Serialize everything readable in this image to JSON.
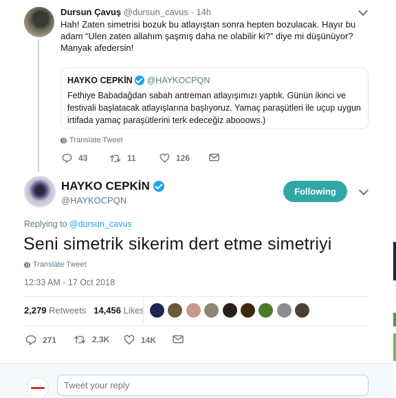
{
  "parent_tweet": {
    "display_name": "Dursun Çavuş",
    "handle": "@dursun_cavus",
    "time": "· 14h",
    "text": "Hah! Zaten simetrisi bozuk bu atlayıştan sonra hepten bozulacak. Hayır bu adam “Ulen zaten allahım şaşmış daha ne olabilir ki?” diye mi düşünüyor? Manyak afedersin!",
    "quoted_tweet": {
      "display_name": "HAYKO CEPKİN",
      "handle": "@HAYKOCPQN",
      "text": "Fethiye Babadağdan sabah antreman atlayışımızı yaptık. Günün ikinci ve festivali başlatacak atlayışlarına başlıyoruz. Yamaç paraşütleri ile uçup uygun irtifada yamaç paraşütlerini terk edeceğiz abooows.)"
    },
    "translate_label": "Translate Tweet",
    "actions": {
      "replies": "43",
      "retweets": "11",
      "likes": "126"
    }
  },
  "main_tweet": {
    "display_name": "HAYKO CEPKİN",
    "handle": "@HAYKOCPQN",
    "follow_label": "Following",
    "replying_prefix": "Replying to",
    "replying_to": "@dursun_cavus",
    "text": "Seni simetrik sikerim dert etme simetriyi",
    "translate_label": "Translate Tweet",
    "timestamp": "12:33 AM - 17 Oct 2018",
    "stats": {
      "retweets_count": "2,279",
      "retweets_label": "Retweets",
      "likes_count": "14,456",
      "likes_label": "Likes"
    },
    "actions": {
      "replies": "271",
      "retweets": "2.3K",
      "likes": "14K"
    }
  },
  "reply_box": {
    "placeholder": "Tweet your reply"
  },
  "colors": {
    "accent": "#1da1f2",
    "follow_button": "#31a8a6",
    "secondary_text": "#657786",
    "border": "#e1e8ed"
  },
  "liker_avatars": [
    {
      "color": "#1f2550"
    },
    {
      "color": "#6b5a38"
    },
    {
      "color": "#c49a8a"
    },
    {
      "color": "#8e8677"
    },
    {
      "color": "#2a1f18"
    },
    {
      "color": "#3a2a10"
    },
    {
      "color": "#4a7a2a"
    },
    {
      "color": "#8c8c8c"
    },
    {
      "color": "#4a4036"
    }
  ]
}
